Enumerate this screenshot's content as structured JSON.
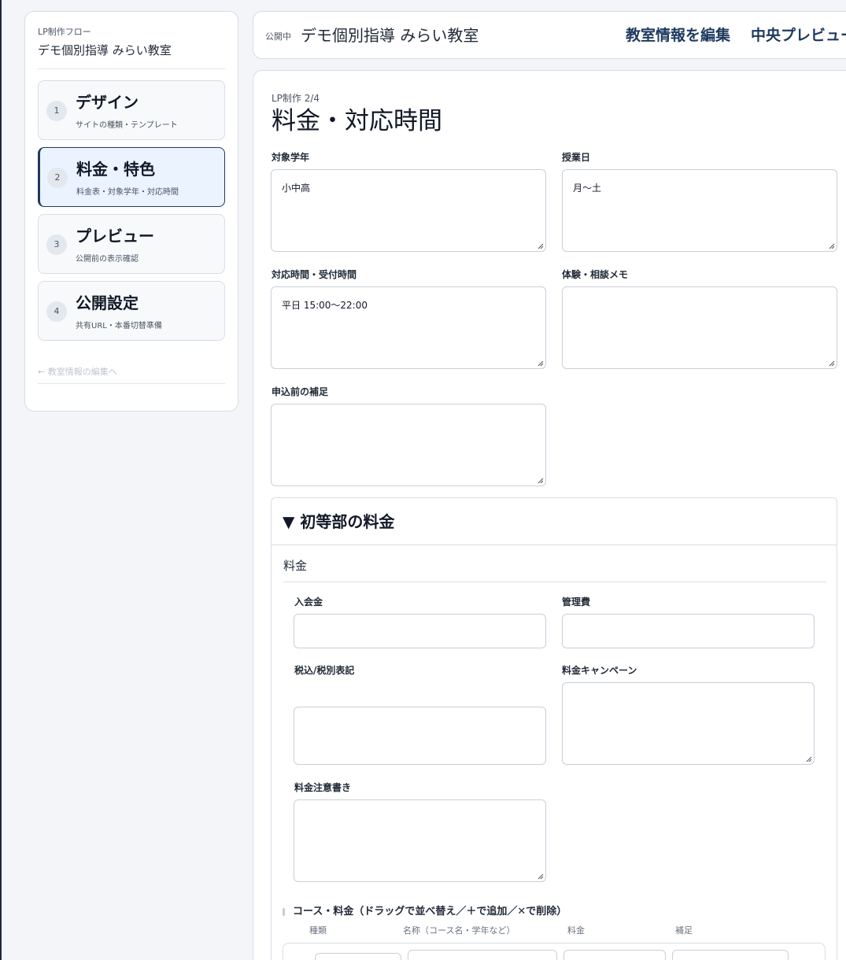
{
  "sidebar": {
    "flow_label": "LP制作フロー",
    "school_name": "デモ個別指導 みらい教室",
    "steps": [
      {
        "num": "1",
        "title": "デザイン",
        "subtitle": "サイトの種類・テンプレート"
      },
      {
        "num": "2",
        "title": "料金・特色",
        "subtitle": "料金表・対象学年・対応時間"
      },
      {
        "num": "3",
        "title": "プレビュー",
        "subtitle": "公開前の表示確認"
      },
      {
        "num": "4",
        "title": "公開設定",
        "subtitle": "共有URL・本番切替準備"
      }
    ],
    "active_step": 2,
    "back_link": "← 教室情報の編集へ"
  },
  "header": {
    "status": "公開中",
    "title": "デモ個別指導 みらい教室",
    "edit_link": "教室情報を編集",
    "preview_link": "中央プレビュー"
  },
  "main": {
    "eyebrow": "LP制作 2/4",
    "title": "料金・対応時間",
    "fields": {
      "target_grades": {
        "label": "対象学年",
        "value": "小中高"
      },
      "lesson_days": {
        "label": "授業日",
        "value": "月〜土"
      },
      "hours": {
        "label": "対応時間・受付時間",
        "value": "平日 15:00〜22:00"
      },
      "trial_memo": {
        "label": "体験・相談メモ",
        "value": ""
      },
      "pre_application": {
        "label": "申込前の補足",
        "value": ""
      }
    },
    "section": {
      "title": "▼ 初等部の料金",
      "subsection": "料金",
      "fields": {
        "admission_fee": {
          "label": "入会金",
          "value": ""
        },
        "management_fee": {
          "label": "管理費",
          "value": ""
        },
        "tax_display": {
          "label": "税込/税別表記",
          "value": ""
        },
        "campaign": {
          "label": "料金キャンペーン",
          "value": ""
        },
        "fee_notes": {
          "label": "料金注意書き",
          "value": ""
        }
      },
      "courses": {
        "heading": "コース・料金（ドラッグで並べ替え／＋で追加／✕で削除）",
        "columns": [
          "種類",
          "名称（コース名・学年など）",
          "料金",
          "補足"
        ]
      }
    }
  },
  "colors": {
    "accent": "#1e3a5f",
    "active_bg": "#eaf3ff",
    "page_bg": "#f3f5f8",
    "border": "#d8dde5"
  }
}
